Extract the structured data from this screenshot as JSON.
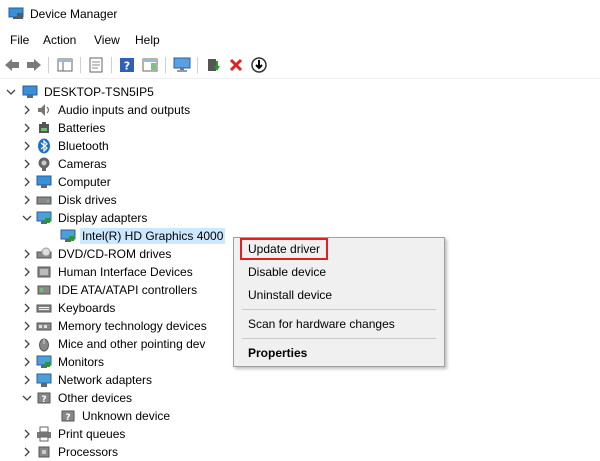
{
  "window": {
    "title": "Device Manager"
  },
  "menu": {
    "items": [
      "File",
      "Action",
      "View",
      "Help"
    ]
  },
  "colors": {
    "accent": "#1a73c8",
    "highlight_box": "#e02020",
    "selection": "#cce8ff",
    "delete": "#e02020",
    "install": "#2a9a2a"
  },
  "tree": {
    "root": "DESKTOP-TSN5IP5",
    "items": [
      {
        "label": "Audio inputs and outputs",
        "icon": "speaker-icon"
      },
      {
        "label": "Batteries",
        "icon": "battery-icon"
      },
      {
        "label": "Bluetooth",
        "icon": "bluetooth-icon"
      },
      {
        "label": "Cameras",
        "icon": "camera-icon"
      },
      {
        "label": "Computer",
        "icon": "computer-icon"
      },
      {
        "label": "Disk drives",
        "icon": "disk-icon"
      },
      {
        "label": "Display adapters",
        "icon": "monitor-icon",
        "expanded": true
      },
      {
        "label": "Intel(R) HD Graphics 4000",
        "icon": "monitor-icon",
        "child": true,
        "selected": true
      },
      {
        "label": "DVD/CD-ROM drives",
        "icon": "dvd-icon"
      },
      {
        "label": "Human Interface Devices",
        "icon": "hid-icon"
      },
      {
        "label": "IDE ATA/ATAPI controllers",
        "icon": "ide-icon"
      },
      {
        "label": "Keyboards",
        "icon": "keyboard-icon"
      },
      {
        "label": "Memory technology devices",
        "icon": "memory-icon"
      },
      {
        "label": "Mice and other pointing dev",
        "icon": "mouse-icon"
      },
      {
        "label": "Monitors",
        "icon": "monitor-icon"
      },
      {
        "label": "Network adapters",
        "icon": "network-icon"
      },
      {
        "label": "Other devices",
        "icon": "unknown-icon",
        "expanded": true
      },
      {
        "label": "Unknown device",
        "icon": "unknown-icon",
        "child": true
      },
      {
        "label": "Print queues",
        "icon": "printer-icon"
      },
      {
        "label": "Processors",
        "icon": "cpu-icon"
      }
    ]
  },
  "context_menu": {
    "update": "Update driver",
    "disable": "Disable device",
    "uninstall": "Uninstall device",
    "scan": "Scan for hardware changes",
    "properties": "Properties"
  }
}
